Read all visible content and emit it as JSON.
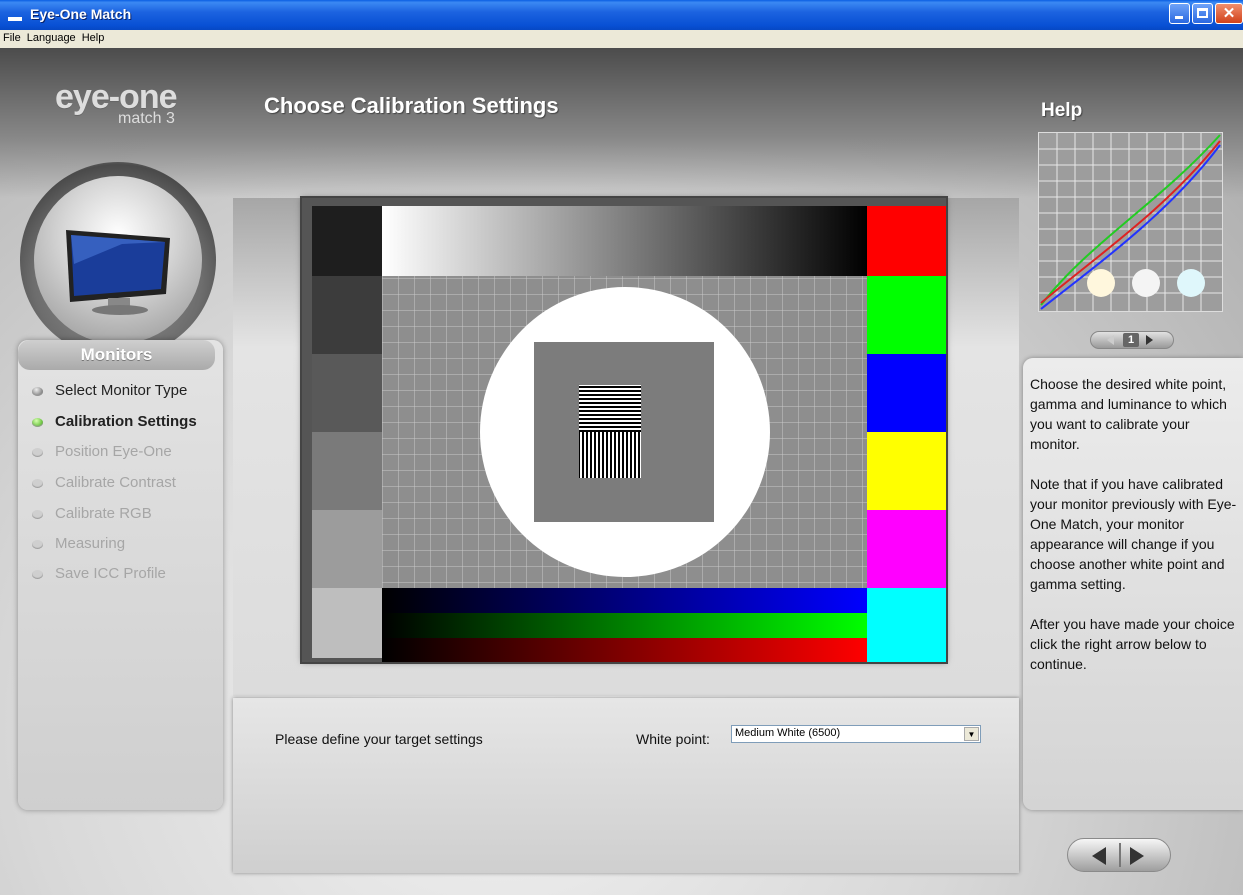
{
  "window": {
    "title": "Eye-One Match"
  },
  "menu": [
    "File",
    "Language",
    "Help"
  ],
  "logo": {
    "brand": "eye-one",
    "product": "match 3"
  },
  "sidebar": {
    "section_title": "Monitors",
    "steps": [
      {
        "label": "Select Monitor Type",
        "state": "done"
      },
      {
        "label": "Calibration Settings",
        "state": "active"
      },
      {
        "label": "Position Eye-One",
        "state": "disabled"
      },
      {
        "label": "Calibrate Contrast",
        "state": "disabled"
      },
      {
        "label": "Calibrate RGB",
        "state": "disabled"
      },
      {
        "label": "Measuring",
        "state": "disabled"
      },
      {
        "label": "Save ICC Profile",
        "state": "disabled"
      }
    ]
  },
  "main": {
    "title": "Choose Calibration Settings",
    "prompt": "Please define your target settings",
    "white_point": {
      "label": "White point:",
      "value": "Medium White (6500)"
    }
  },
  "help": {
    "title": "Help",
    "page": "1",
    "paragraphs": [
      "Choose the desired white point, gamma and luminance to which you want to calibrate your monitor.",
      "Note that if you have calibrated your monitor previously with Eye-One Match, your monitor appearance will change if you choose another white point and gamma setting.",
      "After you have made your choice click the right arrow below to continue."
    ]
  },
  "colors": {
    "titlebar": "#0a5ee3",
    "swatches": [
      "#ff0000",
      "#00ff00",
      "#0000ff",
      "#ffff00",
      "#ff00ff",
      "#00ffff"
    ]
  }
}
